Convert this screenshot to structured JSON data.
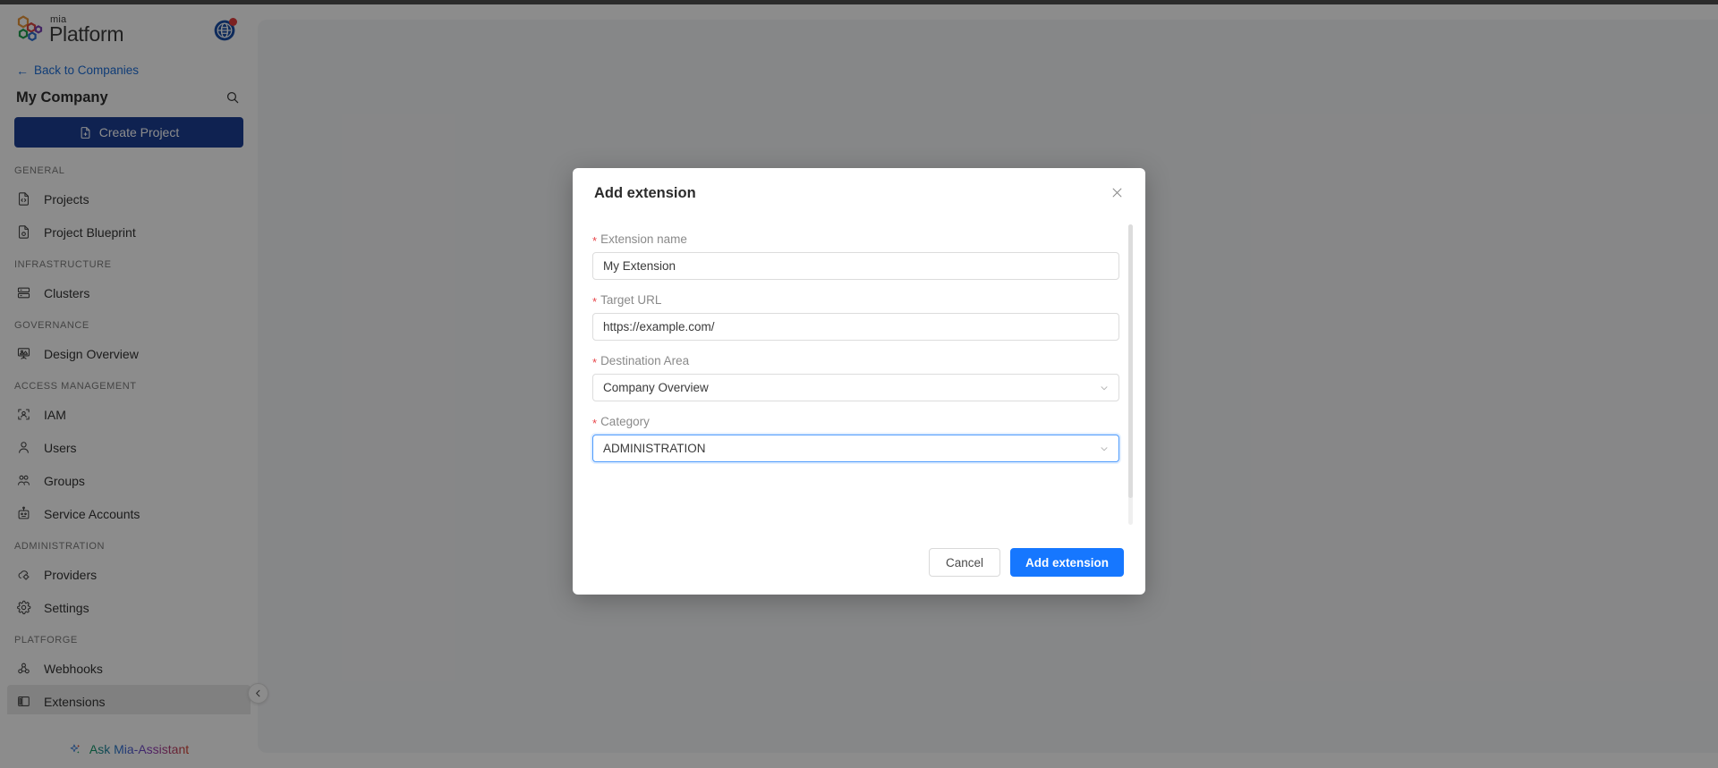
{
  "brand": {
    "name_small": "mia",
    "name_large": "Platform",
    "accent_blue": "#1c3f94",
    "primary_blue": "#1677ff"
  },
  "sidebar": {
    "globe_icon": "globe-icon",
    "notification_dot": true,
    "back_link": "Back to Companies",
    "company_name": "My Company",
    "search_icon": "search-icon",
    "create_button": "Create Project",
    "create_icon": "file-add-icon",
    "sections": [
      {
        "label": "GENERAL",
        "items": [
          {
            "label": "Projects",
            "icon": "file-code-icon",
            "active": false
          },
          {
            "label": "Project Blueprint",
            "icon": "file-blueprint-icon",
            "active": false
          }
        ]
      },
      {
        "label": "INFRASTRUCTURE",
        "items": [
          {
            "label": "Clusters",
            "icon": "server-icon",
            "active": false
          }
        ]
      },
      {
        "label": "GOVERNANCE",
        "items": [
          {
            "label": "Design Overview",
            "icon": "presentation-icon",
            "active": false
          }
        ]
      },
      {
        "label": "ACCESS MANAGEMENT",
        "items": [
          {
            "label": "IAM",
            "icon": "identity-scan-icon",
            "active": false
          },
          {
            "label": "Users",
            "icon": "user-icon",
            "active": false
          },
          {
            "label": "Groups",
            "icon": "group-icon",
            "active": false
          },
          {
            "label": "Service Accounts",
            "icon": "robot-icon",
            "active": false
          }
        ]
      },
      {
        "label": "ADMINISTRATION",
        "items": [
          {
            "label": "Providers",
            "icon": "cloud-gear-icon",
            "active": false
          },
          {
            "label": "Settings",
            "icon": "gear-icon",
            "active": false
          }
        ]
      },
      {
        "label": "PLATFORGE",
        "items": [
          {
            "label": "Webhooks",
            "icon": "webhook-icon",
            "active": false
          },
          {
            "label": "Extensions",
            "icon": "panel-layout-icon",
            "active": true
          }
        ]
      }
    ],
    "assistant_label": "Ask Mia-Assistant",
    "assistant_icon": "sparkle-icon",
    "collapse_icon": "chevron-left-icon"
  },
  "modal": {
    "title": "Add extension",
    "close_icon": "close-icon",
    "fields": [
      {
        "label": "Extension name",
        "required": true,
        "type": "text",
        "value": "My Extension",
        "focused": false
      },
      {
        "label": "Target URL",
        "required": true,
        "type": "text",
        "value": "https://example.com/",
        "focused": false
      },
      {
        "label": "Destination Area",
        "required": true,
        "type": "select",
        "value": "Company Overview",
        "focused": false
      },
      {
        "label": "Category",
        "required": true,
        "type": "select",
        "value": "ADMINISTRATION",
        "focused": true
      }
    ],
    "cancel_label": "Cancel",
    "submit_label": "Add extension"
  }
}
